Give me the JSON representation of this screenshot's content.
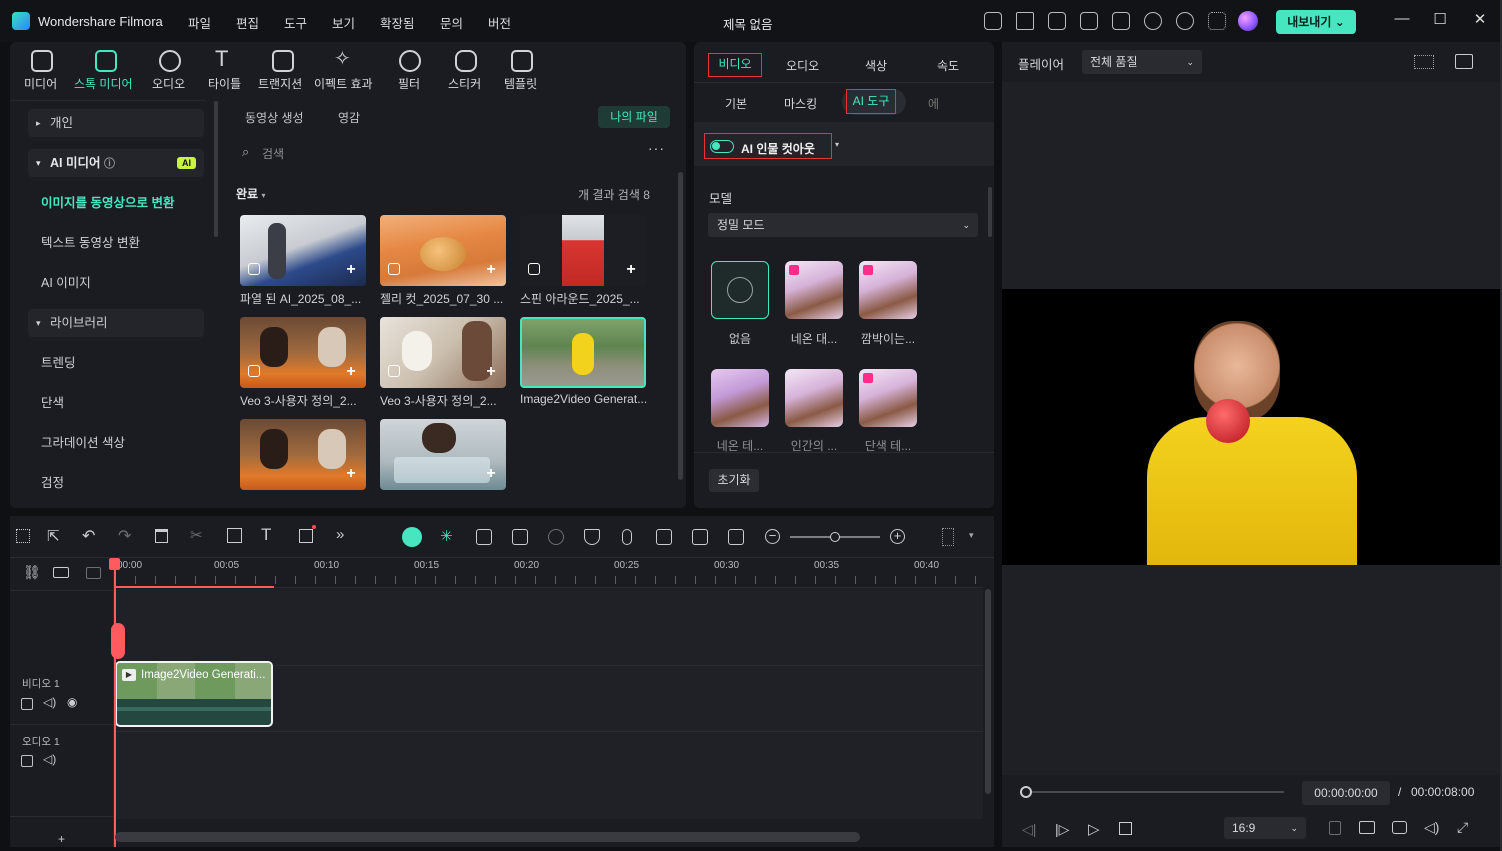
{
  "titlebar": {
    "app": "Wondershare Filmora",
    "menus": [
      "파일",
      "편집",
      "도구",
      "보기",
      "확장됨",
      "문의",
      "버전"
    ],
    "title": "제목 없음",
    "export": "내보내기"
  },
  "toolbar": {
    "items": [
      "미디어",
      "스톡 미디어",
      "오디오",
      "타이틀",
      "트랜지션",
      "이펙트 효과",
      "필터",
      "스티커",
      "템플릿"
    ],
    "active": "스톡 미디어"
  },
  "sidebar": {
    "items": [
      "개인",
      "AI 미디어",
      "이미지를 동영상으로 변환",
      "텍스트 동영상 변환",
      "AI 이미지",
      "라이브러리",
      "트렌딩",
      "단색",
      "그라데이션 색상",
      "검정"
    ],
    "ai_badge": "AI"
  },
  "media": {
    "tabs": [
      "동영상 생성",
      "영감"
    ],
    "my_files": "나의 파일",
    "search_placeholder": "검색",
    "filter": "완료",
    "result_count": "개 결과 검색 8",
    "items": [
      "파열 된 AI_2025_08_...",
      "젤리 컷_2025_07_30 ...",
      "스핀 아라운드_2025_...",
      "Veo 3-사용자 정의_2...",
      "Veo 3-사용자 정의_2...",
      "Image2Video Generat...",
      "",
      "",
      ""
    ]
  },
  "props": {
    "tabs": [
      "비디오",
      "오디오",
      "색상",
      "속도"
    ],
    "subtabs": [
      "기본",
      "마스킹",
      "AI 도구",
      "에"
    ],
    "cutout": "AI 인물 컷아웃",
    "model_label": "모델",
    "model_value": "정밀 모드",
    "presets": [
      "없음",
      "네온 대...",
      "깜박이는...",
      "네온 테...",
      "인간의 ...",
      "단색 테..."
    ],
    "reset": "초기화"
  },
  "player": {
    "label": "플레이어",
    "quality": "전체 품질",
    "time_current": "00:00:00:00",
    "separator": "/",
    "time_total": "00:00:08:00",
    "ratio": "16:9",
    "progress": 0.0
  },
  "timeline": {
    "ticks": [
      "00:00",
      "00:05",
      "00:10",
      "00:15",
      "00:20",
      "00:25",
      "00:30",
      "00:35",
      "00:40"
    ],
    "tracks": [
      "비디오 1",
      "오디오 1"
    ],
    "clip_label": "Image2Video Generati..."
  },
  "colors": {
    "accent": "#46e6c1",
    "highlight_box": "#e8333c",
    "playhead": "#ff5a5f"
  }
}
